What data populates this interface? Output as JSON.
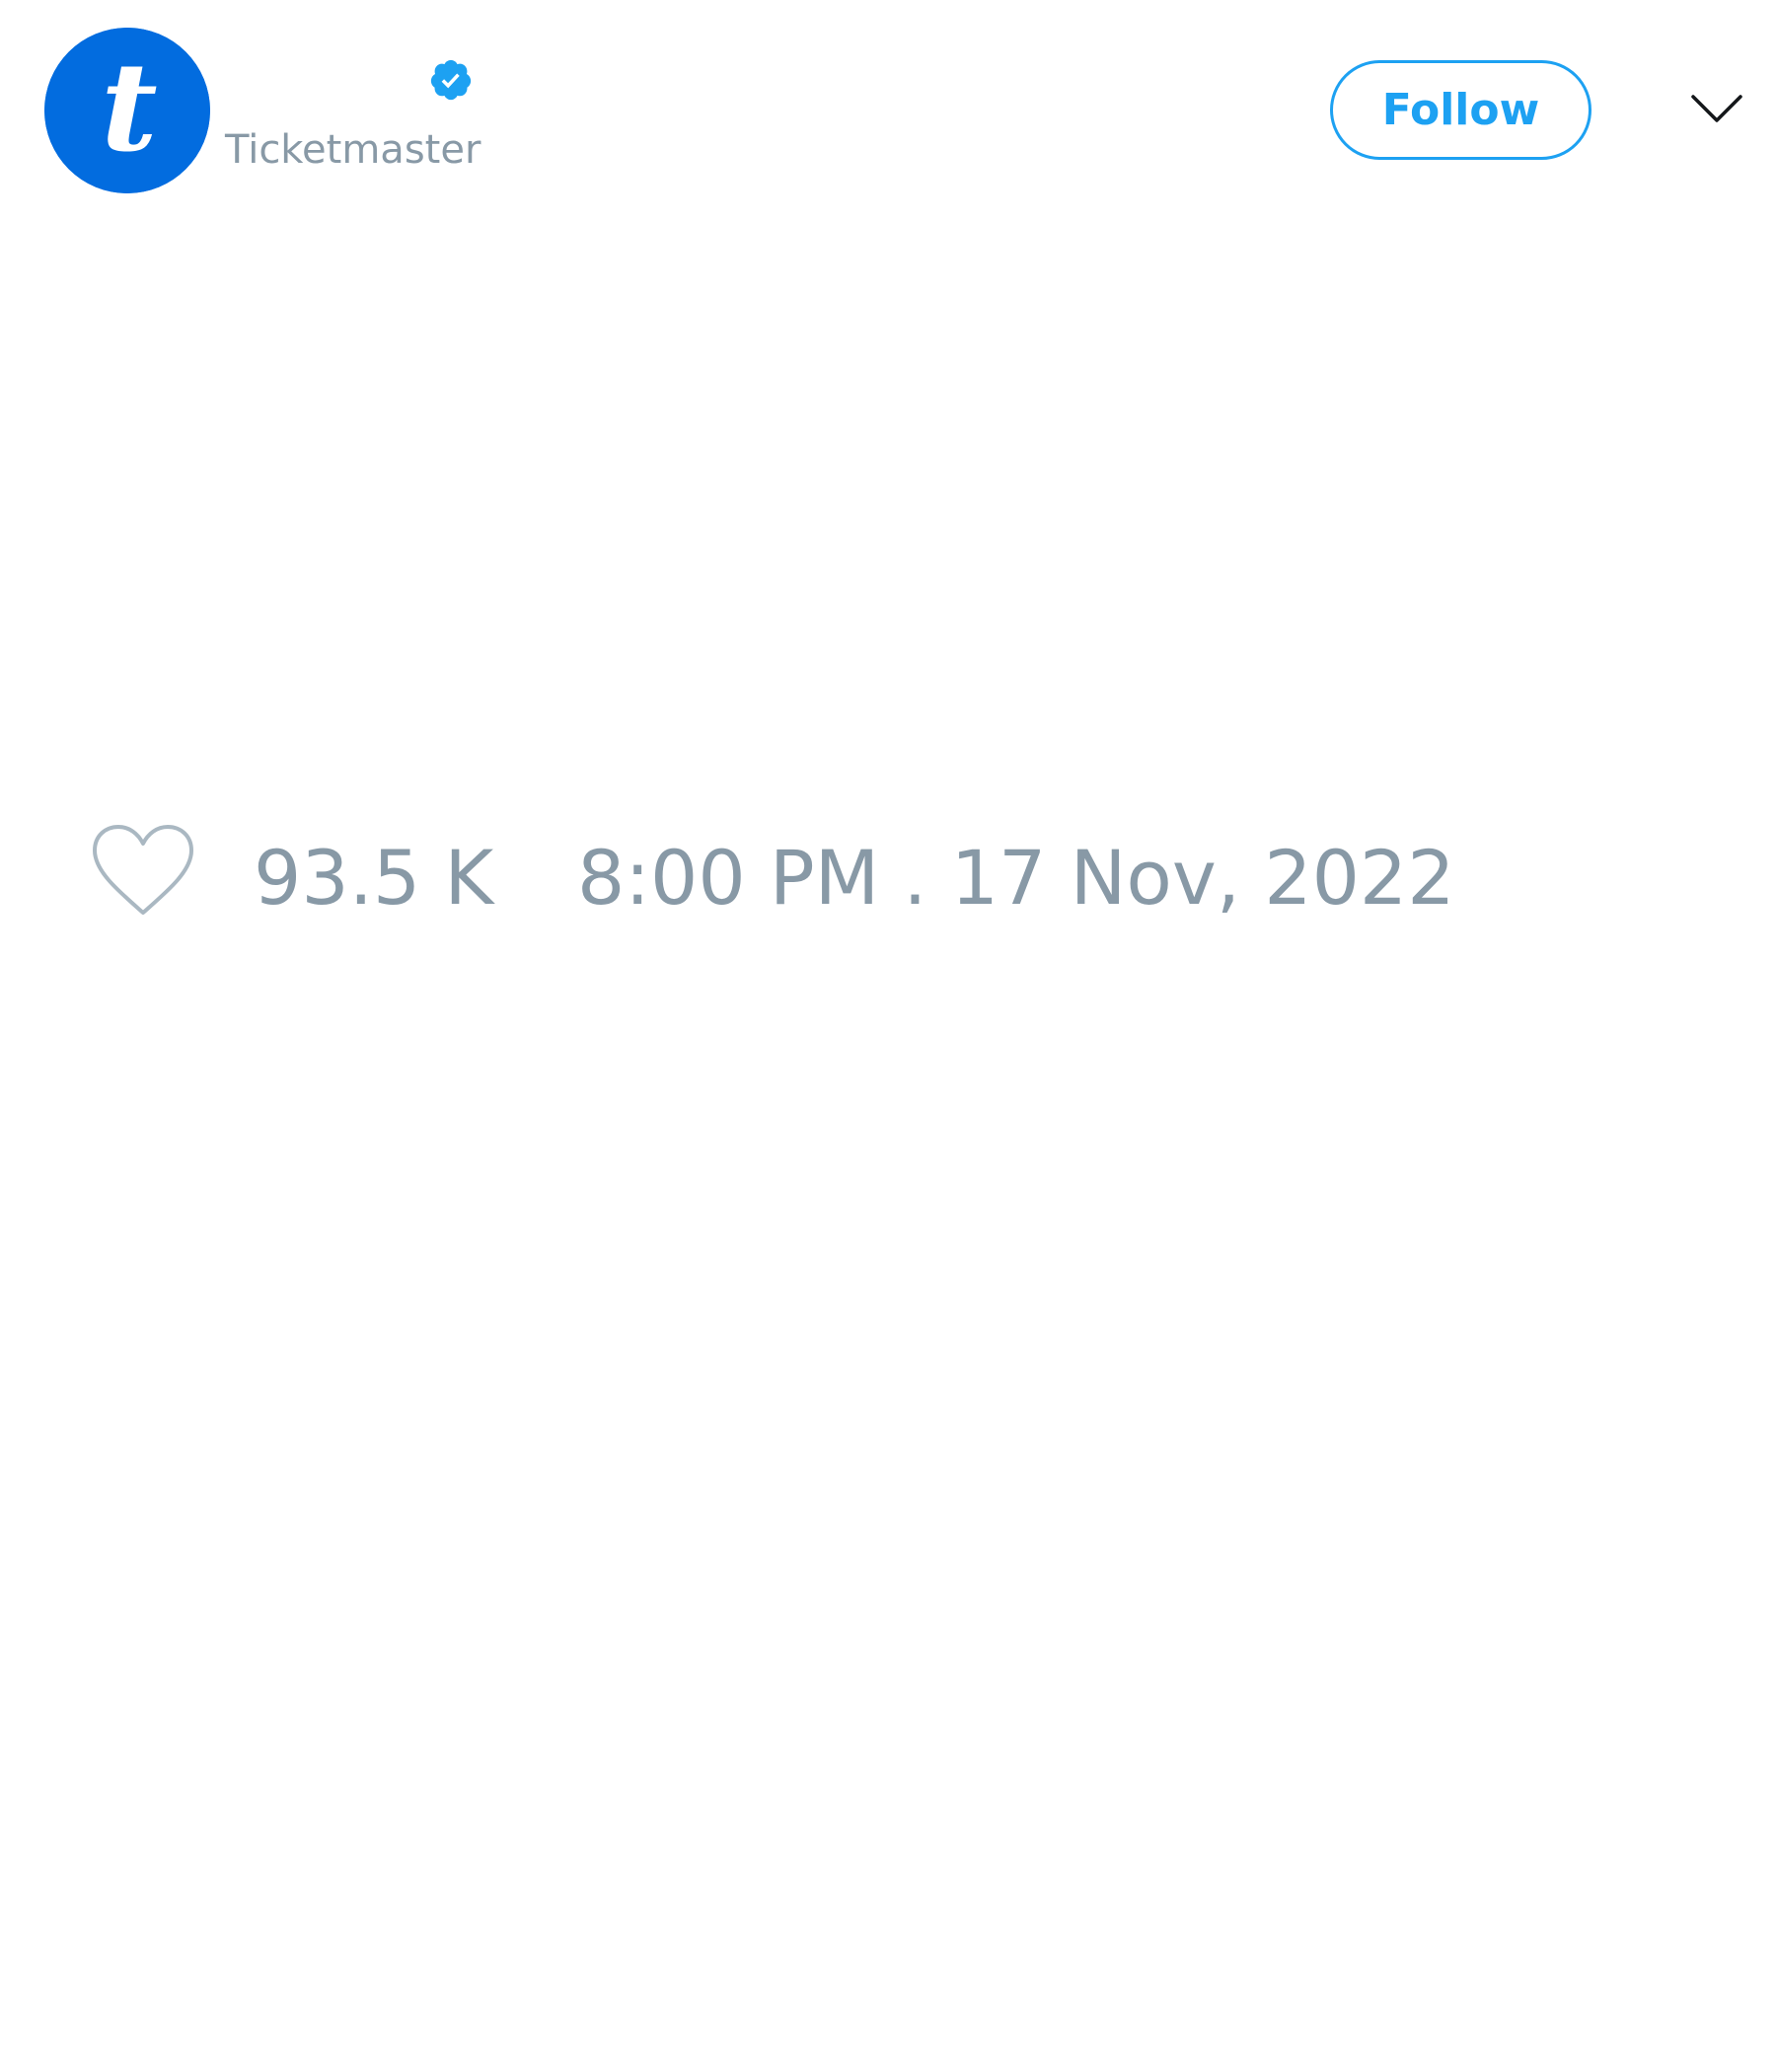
{
  "tweet": {
    "author": {
      "handle": "Ticketmaster",
      "avatar_letter": "t",
      "avatar_color": "#026cdf",
      "verified": true,
      "verified_icon": "verified-badge-icon"
    },
    "actions": {
      "follow_label": "Follow",
      "menu_icon": "chevron-down-icon"
    },
    "footer": {
      "like_icon": "heart-icon",
      "like_count": "93.5 K",
      "timestamp": "8:00 PM . 17 Nov, 2022"
    }
  },
  "colors": {
    "accent": "#1da1f2",
    "muted_text": "#8899a6",
    "brand": "#026cdf",
    "background": "#ffffff"
  }
}
